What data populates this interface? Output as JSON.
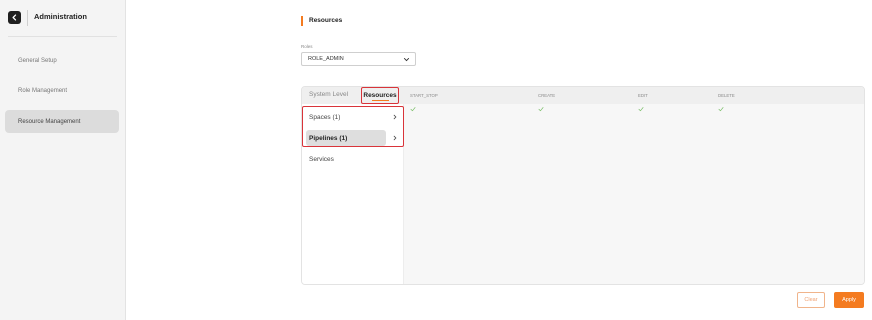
{
  "sidebar": {
    "title": "Administration",
    "items": [
      {
        "label": "General Setup"
      },
      {
        "label": "Role Management"
      },
      {
        "label": "Resource Management"
      }
    ]
  },
  "main": {
    "section_title": "Resources",
    "roles_label": "Roles",
    "roles_value": "ROLE_ADMIN",
    "tabs": [
      {
        "label": "System Level"
      },
      {
        "label": "Resources"
      }
    ],
    "columns": [
      "START_STOP",
      "CREATE",
      "EDIT",
      "DELETE"
    ],
    "resource_items": [
      {
        "label": "Spaces (1)"
      },
      {
        "label": "Pipelines (1)"
      },
      {
        "label": "Services"
      }
    ],
    "clear_label": "Clear",
    "apply_label": "Apply"
  },
  "colors": {
    "accent": "#f47b20",
    "highlight": "#d9343a",
    "check": "#7cbf6a"
  },
  "icons": [
    "back-arrow-icon",
    "chevron-down-icon",
    "check-icon",
    "chevron-right-icon"
  ]
}
